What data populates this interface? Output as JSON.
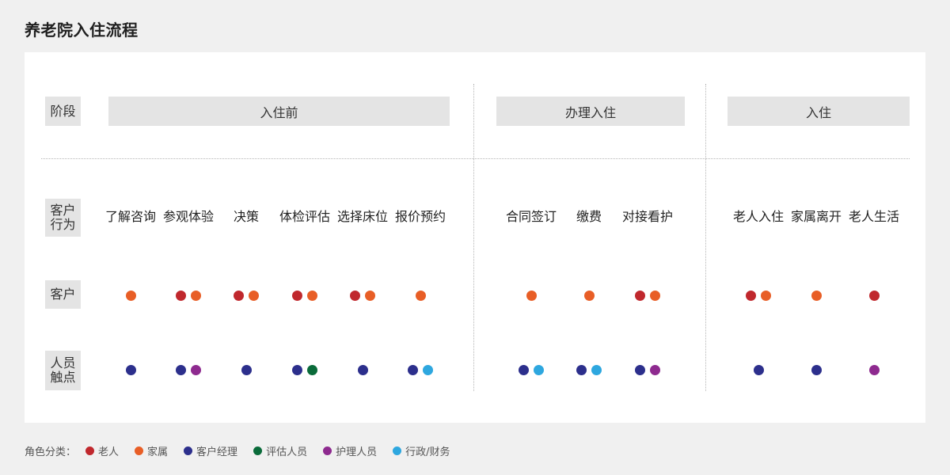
{
  "title": "养老院入住流程",
  "row_labels": {
    "stage": "阶段",
    "behavior": "客户行为",
    "customer": "客户",
    "staff": "人员触点"
  },
  "stages": [
    "入住前",
    "办理入住",
    "入住"
  ],
  "actions": [
    {
      "label": "了解咨询",
      "customer": [
        "elder_or_family_family"
      ],
      "staff": [
        "manager"
      ]
    },
    {
      "label": "参观体验",
      "customer": [
        "elder",
        "family"
      ],
      "staff": [
        "manager",
        "nurse"
      ]
    },
    {
      "label": "决策",
      "customer": [
        "elder",
        "family"
      ],
      "staff": [
        "manager"
      ]
    },
    {
      "label": "体检评估",
      "customer": [
        "elder",
        "family"
      ],
      "staff": [
        "manager",
        "assessor"
      ]
    },
    {
      "label": "选择床位",
      "customer": [
        "elder",
        "family"
      ],
      "staff": [
        "manager"
      ]
    },
    {
      "label": "报价预约",
      "customer": [
        "family"
      ],
      "staff": [
        "manager",
        "admin"
      ]
    },
    {
      "label": "合同签订",
      "customer": [
        "family"
      ],
      "staff": [
        "manager",
        "admin"
      ]
    },
    {
      "label": "缴费",
      "customer": [
        "family"
      ],
      "staff": [
        "manager",
        "admin"
      ]
    },
    {
      "label": "对接看护",
      "customer": [
        "elder",
        "family"
      ],
      "staff": [
        "manager",
        "nurse"
      ]
    },
    {
      "label": "老人入住",
      "customer": [
        "elder",
        "family"
      ],
      "staff": [
        "manager"
      ]
    },
    {
      "label": "家属离开",
      "customer": [
        "family"
      ],
      "staff": [
        "manager"
      ]
    },
    {
      "label": "老人生活",
      "customer": [
        "elder"
      ],
      "staff": [
        "nurse"
      ]
    }
  ],
  "legend": {
    "title": "角色分类：",
    "items": [
      {
        "key": "elder",
        "label": "老人",
        "color": "#c0282d"
      },
      {
        "key": "family",
        "label": "家属",
        "color": "#e85e26"
      },
      {
        "key": "manager",
        "label": "客户经理",
        "color": "#2c2f8c"
      },
      {
        "key": "assessor",
        "label": "评估人员",
        "color": "#0a6b3a"
      },
      {
        "key": "nurse",
        "label": "护理人员",
        "color": "#8e2a8f"
      },
      {
        "key": "admin",
        "label": "行政/财务",
        "color": "#2ea7df"
      }
    ]
  }
}
